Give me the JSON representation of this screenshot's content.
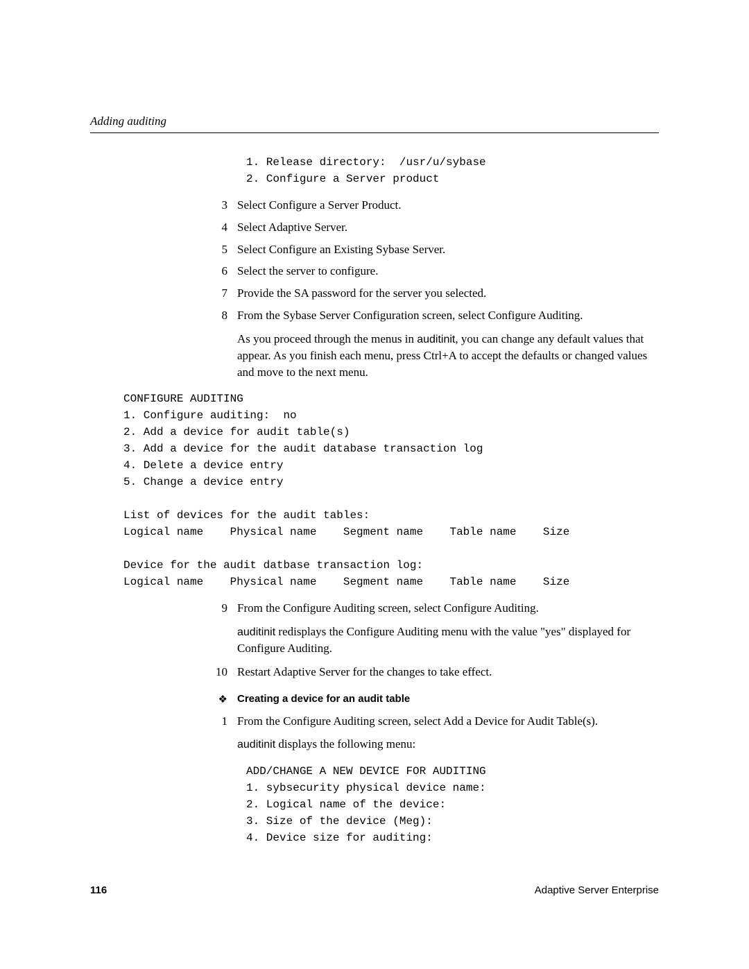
{
  "header": "Adding auditing",
  "code1": "1. Release directory:  /usr/u/sybase\n2. Configure a Server product",
  "steps_a": [
    {
      "n": "3",
      "t": "Select Configure a Server Product."
    },
    {
      "n": "4",
      "t": "Select Adaptive Server."
    },
    {
      "n": "5",
      "t": "Select Configure an Existing Sybase Server."
    },
    {
      "n": "6",
      "t": "Select the server to configure."
    },
    {
      "n": "7",
      "t": "Provide the SA password for the server you selected."
    },
    {
      "n": "8",
      "t": "From the Sybase Server Configuration screen, select Configure Auditing."
    }
  ],
  "para1_pre": "As you proceed through the menus in ",
  "auditinit": "auditinit",
  "para1_post": ", you can change any default values that appear. As you finish each menu, press Ctrl+A to accept the defaults or changed values and move to the next menu.",
  "code2": "CONFIGURE AUDITING\n1. Configure auditing:  no\n2. Add a device for audit table(s)\n3. Add a device for the audit database transaction log\n4. Delete a device entry\n5. Change a device entry\n\nList of devices for the audit tables:\nLogical name    Physical name    Segment name    Table name    Size\n\nDevice for the audit datbase transaction log:\nLogical name    Physical name    Segment name    Table name    Size",
  "steps_b": [
    {
      "n": "9",
      "t": "From the Configure Auditing screen, select Configure Auditing."
    }
  ],
  "para2_mid": " redisplays the Configure Auditing menu with the value \"yes\" displayed for Configure Auditing.",
  "steps_c": [
    {
      "n": "10",
      "t": "Restart Adaptive Server for the changes to take effect."
    }
  ],
  "subheading_mark": "❖",
  "subheading": "Creating a device for an audit table",
  "steps_d": [
    {
      "n": "1",
      "t": "From the Configure Auditing screen, select Add a Device for Audit Table(s)."
    }
  ],
  "para3_post": " displays the following menu:",
  "code3": "ADD/CHANGE A NEW DEVICE FOR AUDITING\n1. sybsecurity physical device name:\n2. Logical name of the device:\n3. Size of the device (Meg):\n4. Device size for auditing:",
  "footer": {
    "page": "116",
    "product": "Adaptive Server Enterprise"
  }
}
